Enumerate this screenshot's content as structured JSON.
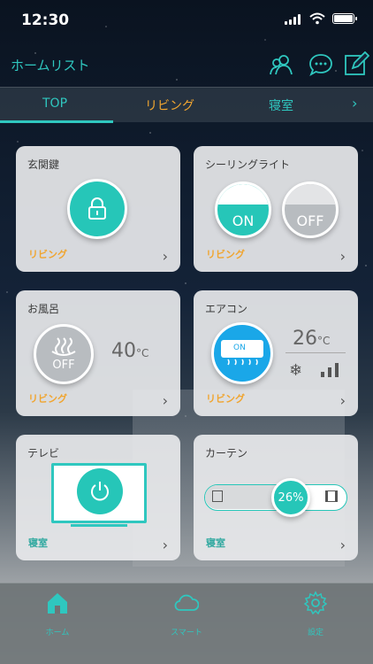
{
  "status_bar": {
    "time": "12:30"
  },
  "header": {
    "title": "ホームリスト",
    "icons": [
      "users-icon",
      "chat-bubble-icon",
      "edit-icon"
    ]
  },
  "tabs": [
    {
      "label": "TOP",
      "active": true
    },
    {
      "label": "リビング",
      "active": false
    },
    {
      "label": "寝室",
      "active": false
    }
  ],
  "cards": {
    "door_lock": {
      "title": "玄関鍵",
      "room": "リビング",
      "icon": "lock-icon"
    },
    "ceiling_light": {
      "title": "シーリングライト",
      "room": "リビング",
      "on_label": "ON",
      "off_label": "OFF"
    },
    "bath": {
      "title": "お風呂",
      "room": "リビング",
      "state_label": "OFF",
      "temperature": "40",
      "unit": "°C",
      "icon": "bath-hot-water-icon"
    },
    "aircon": {
      "title": "エアコン",
      "room": "リビング",
      "state_label": "ON",
      "temperature": "26",
      "unit": "°C",
      "mode_icon": "snowflake-icon",
      "fan_icon": "signal-bars-icon"
    },
    "tv": {
      "title": "テレビ",
      "room": "寝室",
      "icon": "power-icon"
    },
    "curtain": {
      "title": "カーテン",
      "room": "寝室",
      "percent": "26%",
      "position": 0.26
    }
  },
  "bottom_nav": [
    {
      "label": "ホーム",
      "icon": "home-icon",
      "active": true
    },
    {
      "label": "スマート",
      "icon": "cloud-icon",
      "active": false
    },
    {
      "label": "設定",
      "icon": "gear-icon",
      "active": false
    }
  ],
  "colors": {
    "accent": "#2fc7bf",
    "room_orange": "#f0a530",
    "teal_button": "#26c6b8",
    "ac_blue": "#1aa7e8"
  }
}
